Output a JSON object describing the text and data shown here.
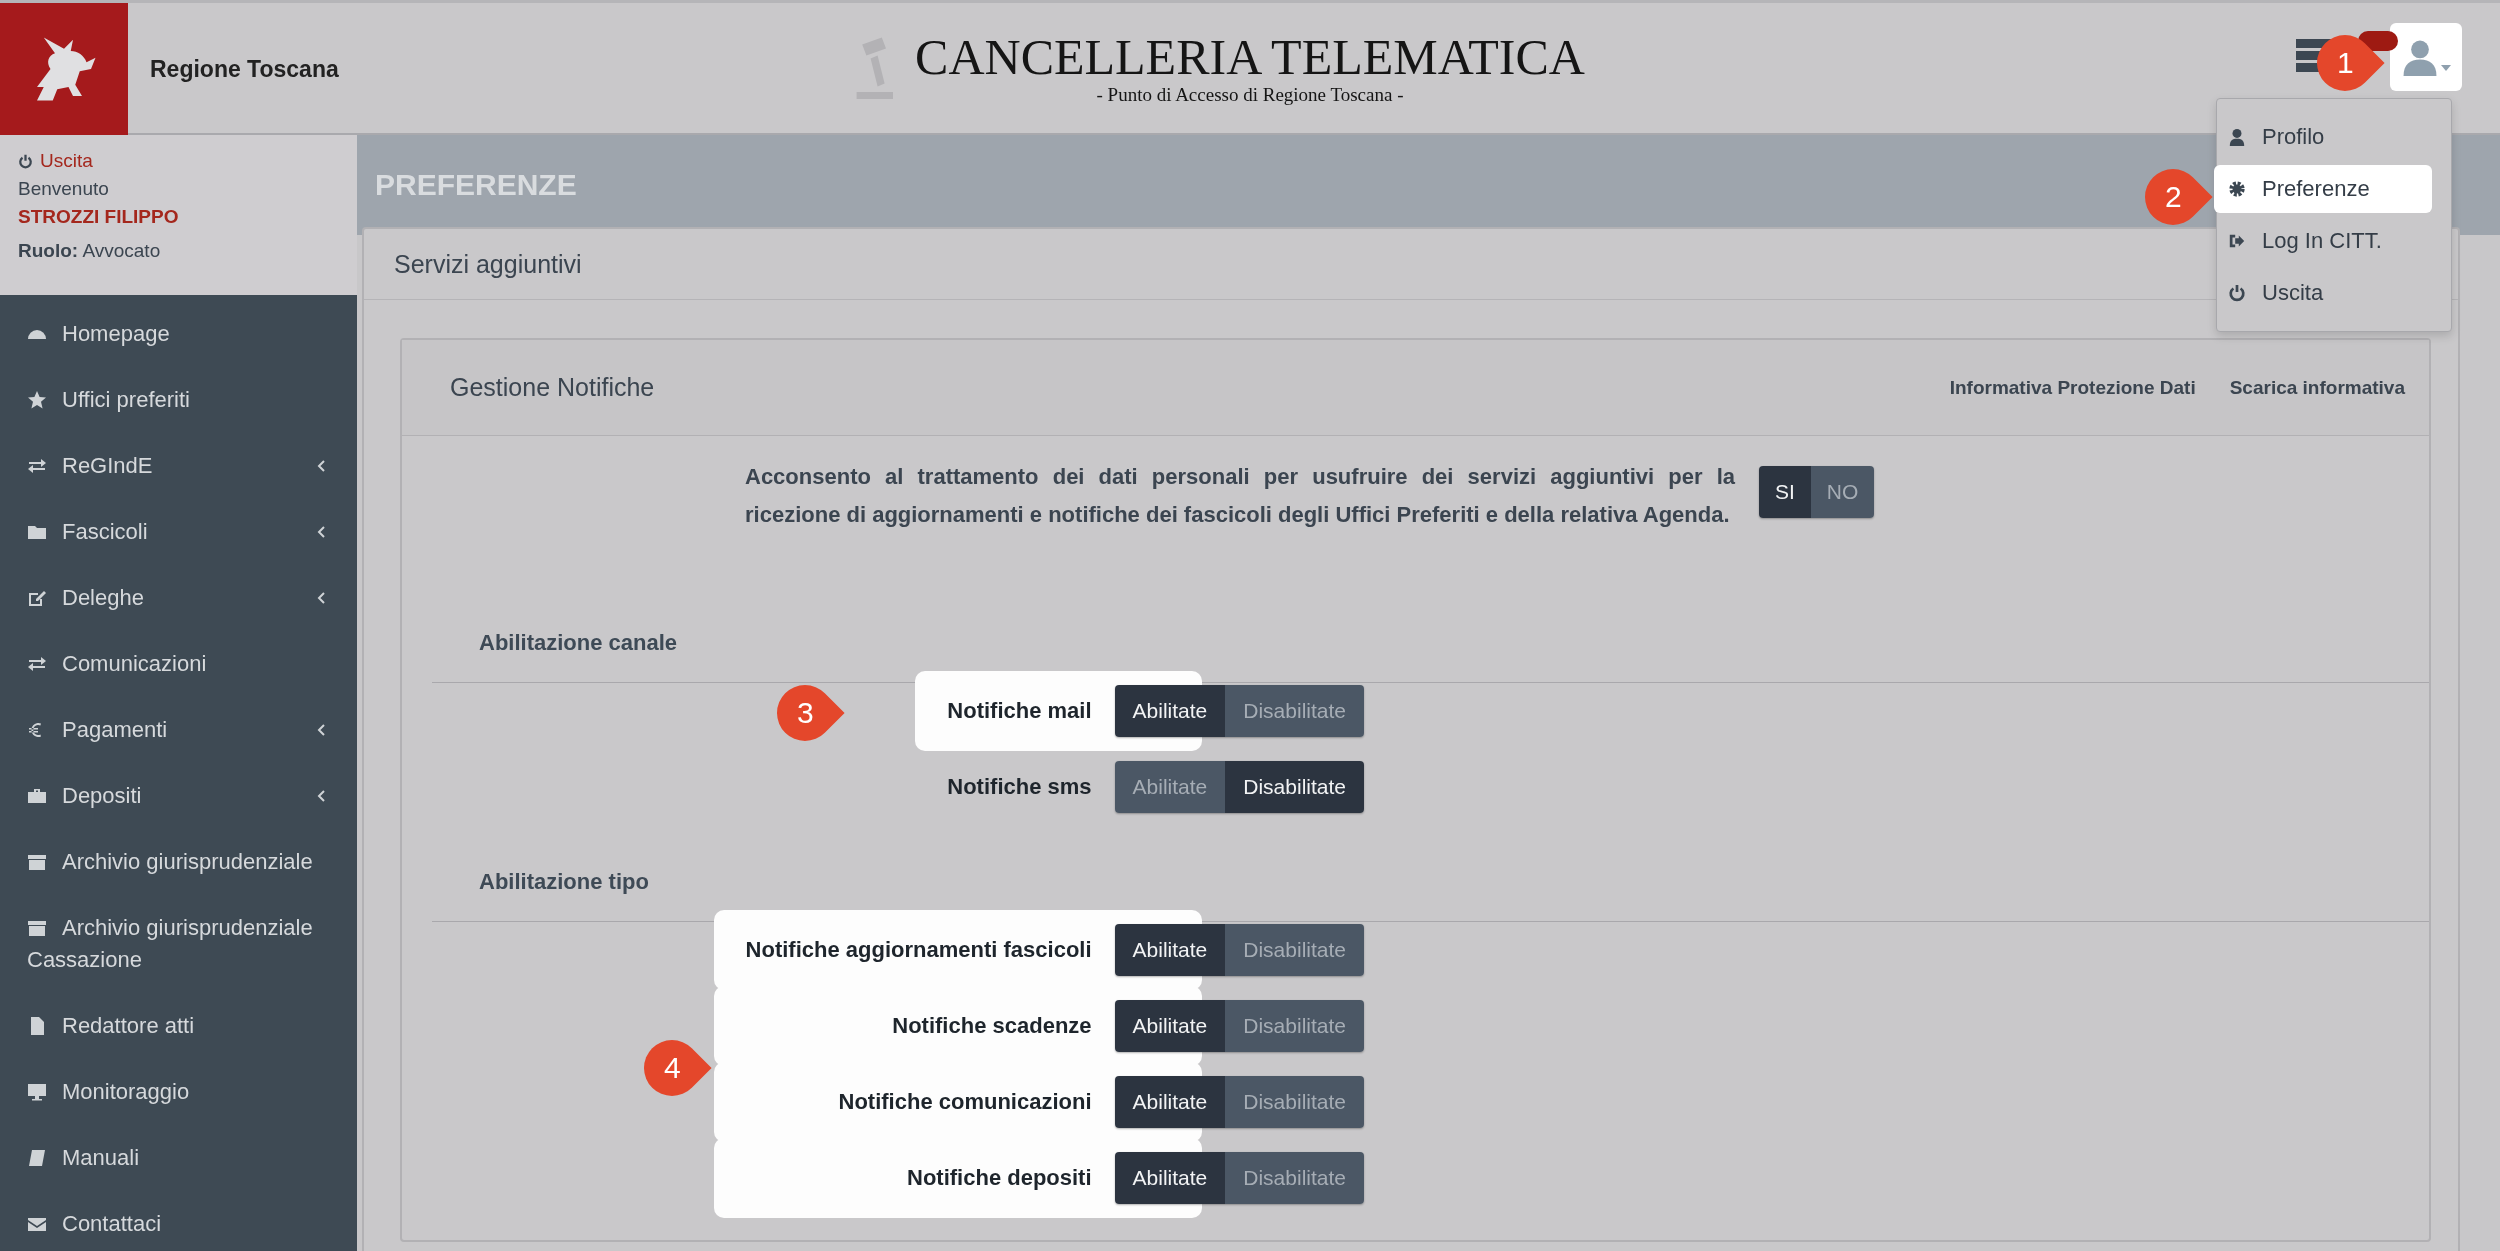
{
  "header": {
    "brand": "Regione Toscana",
    "title": "CANCELLERIA TELEMATICA",
    "subtitle": "- Punto di Accesso di Regione Toscana -"
  },
  "user_menu": {
    "items": [
      {
        "label": "Profilo",
        "highlighted": false
      },
      {
        "label": "Preferenze",
        "highlighted": true
      },
      {
        "label": "Log In CITT.",
        "highlighted": false
      },
      {
        "label": "Uscita",
        "highlighted": false
      }
    ]
  },
  "user": {
    "logout": "Uscita",
    "greeting": "Benvenuto",
    "name": "STROZZI FILIPPO",
    "role_label": "Ruolo:",
    "role": "Avvocato"
  },
  "sidebar": {
    "items": [
      {
        "label": "Homepage",
        "expandable": false
      },
      {
        "label": "Uffici preferiti",
        "expandable": false
      },
      {
        "label": "ReGIndE",
        "expandable": true
      },
      {
        "label": "Fascicoli",
        "expandable": true
      },
      {
        "label": "Deleghe",
        "expandable": true
      },
      {
        "label": "Comunicazioni",
        "expandable": false
      },
      {
        "label": "Pagamenti",
        "expandable": true
      },
      {
        "label": "Depositi",
        "expandable": true
      },
      {
        "label": "Archivio giurisprudenziale",
        "expandable": false
      },
      {
        "label": "Archivio giurisprudenziale Cassazione",
        "expandable": false
      },
      {
        "label": "Redattore atti",
        "expandable": false
      },
      {
        "label": "Monitoraggio",
        "expandable": false
      },
      {
        "label": "Manuali",
        "expandable": false
      },
      {
        "label": "Contattaci",
        "expandable": false
      }
    ]
  },
  "page_title": "PREFERENZE",
  "panel": {
    "title": "Servizi aggiuntivi"
  },
  "notifications": {
    "title": "Gestione Notifiche",
    "links": [
      "Informativa Protezione Dati",
      "Scarica informativa"
    ],
    "consent": {
      "text": "Acconsento al trattamento dei dati personali per usufruire dei servizi aggiuntivi per la ricezione di aggiornamenti e notifiche dei fascicoli degli Uffici Preferiti e della relativa Agenda.",
      "options": [
        {
          "label": "SI",
          "selected": true
        },
        {
          "label": "NO",
          "selected": false
        }
      ]
    },
    "sections": [
      {
        "title": "Abilitazione canale",
        "rows": [
          {
            "label": "Notifiche mail",
            "highlighted": true,
            "options": [
              {
                "label": "Abilitate",
                "selected": true
              },
              {
                "label": "Disabilitate",
                "selected": false
              }
            ]
          },
          {
            "label": "Notifiche sms",
            "highlighted": false,
            "options": [
              {
                "label": "Abilitate",
                "selected": false
              },
              {
                "label": "Disabilitate",
                "selected": true
              }
            ]
          }
        ]
      },
      {
        "title": "Abilitazione tipo",
        "rows": [
          {
            "label": "Notifiche aggiornamenti fascicoli",
            "highlighted": true,
            "options": [
              {
                "label": "Abilitate",
                "selected": true
              },
              {
                "label": "Disabilitate",
                "selected": false
              }
            ]
          },
          {
            "label": "Notifiche scadenze",
            "highlighted": true,
            "options": [
              {
                "label": "Abilitate",
                "selected": true
              },
              {
                "label": "Disabilitate",
                "selected": false
              }
            ]
          },
          {
            "label": "Notifiche comunicazioni",
            "highlighted": true,
            "options": [
              {
                "label": "Abilitate",
                "selected": true
              },
              {
                "label": "Disabilitate",
                "selected": false
              }
            ]
          },
          {
            "label": "Notifiche depositi",
            "highlighted": true,
            "options": [
              {
                "label": "Abilitate",
                "selected": true
              },
              {
                "label": "Disabilitate",
                "selected": false
              }
            ]
          }
        ]
      }
    ]
  },
  "callouts": [
    {
      "label": "1"
    },
    {
      "label": "2"
    },
    {
      "label": "3"
    },
    {
      "label": "4"
    }
  ]
}
